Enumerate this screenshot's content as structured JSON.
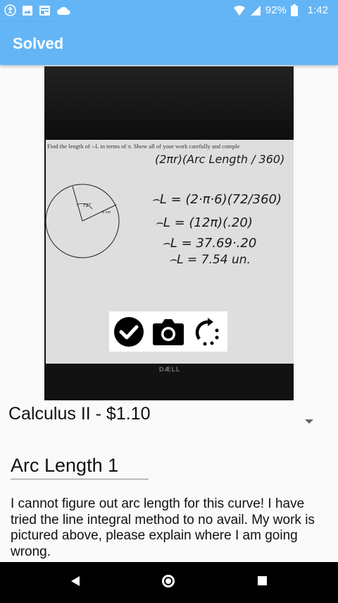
{
  "status_bar": {
    "battery": "92%",
    "time": "1:42",
    "icons": [
      "accessibility-icon",
      "image-icon",
      "news-icon",
      "cloud-icon",
      "wifi-icon",
      "signal-icon",
      "battery-icon"
    ]
  },
  "app_bar": {
    "title": "Solved"
  },
  "photo": {
    "problem_text": "Find the length of ⌢L in terms of π. Show all of your work carefully and comple",
    "handwriting": [
      "(2πr)(Arc Length / 360)",
      "⌢L = (2·π·6)(72/360)",
      "⌢L = (12π)(.20)",
      "⌢L = 37.69·.20",
      "⌢L = 7.54 un."
    ],
    "diagram": {
      "angle_label": "72°",
      "radius_label": "6 cm"
    },
    "monitor_brand": "DÆLL"
  },
  "camera_toolbar": {
    "buttons": [
      "confirm-icon",
      "camera-icon",
      "rotate-icon"
    ]
  },
  "course": {
    "selected": "Calculus II - $1.10"
  },
  "question_title": {
    "value": "Arc Length 1"
  },
  "question_body": {
    "value": "I cannot figure out arc length for this curve! I have tried the line integral method to no avail. My work is pictured above, please explain where I am going wrong."
  },
  "nav_bar": {
    "icons": [
      "back-icon",
      "home-icon",
      "recents-icon"
    ]
  },
  "colors": {
    "primary": "#64b5f6",
    "background": "#fafafa"
  }
}
